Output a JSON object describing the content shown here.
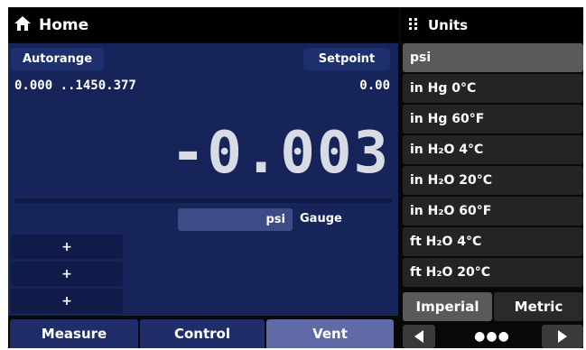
{
  "left": {
    "title": "Home",
    "autorange_label": "Autorange",
    "setpoint_label": "Setpoint",
    "range_text": "0.000 ..1450.377",
    "setpoint_value": "0.00",
    "reading": "-0.003",
    "unit": "psi",
    "mode": "Gauge",
    "plus_buttons": [
      "+",
      "+",
      "+"
    ],
    "tabs": [
      "Measure",
      "Control",
      "Vent"
    ],
    "active_tab": "Vent"
  },
  "right": {
    "title": "Units",
    "units": [
      "psi",
      "in Hg 0°C",
      "in Hg 60°F",
      "in H₂O 4°C",
      "in H₂O 20°C",
      "in H₂O 60°F",
      "ft H₂O 4°C",
      "ft H₂O 20°C"
    ],
    "selected_unit": "psi",
    "segments": [
      "Imperial",
      "Metric"
    ],
    "active_segment": "Imperial",
    "page_dots": "●●●"
  },
  "colors": {
    "panel_blue": "#17245a",
    "accent_vent": "#5f6aa6",
    "dark": "#080808"
  }
}
